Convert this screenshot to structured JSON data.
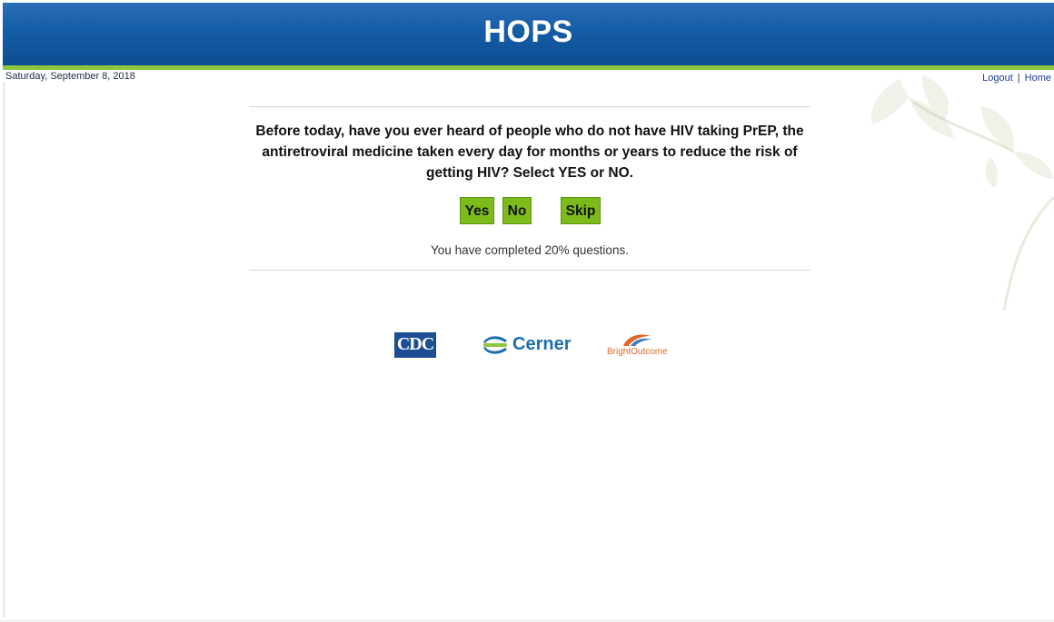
{
  "header": {
    "title": "HOPS"
  },
  "date": "Saturday, September 8, 2018",
  "nav": {
    "logout": "Logout",
    "separator": "|",
    "home": "Home"
  },
  "question": {
    "text": "Before today, have you ever heard of people who do not have HIV taking PrEP, the antiretroviral medicine taken every day for months or years to reduce the risk of getting HIV? Select YES or NO."
  },
  "buttons": {
    "yes": "Yes",
    "no": "No",
    "skip": "Skip"
  },
  "progress": {
    "text": "You have completed 20% questions.",
    "percent": 20
  },
  "logos": {
    "cdc": "CDC",
    "cerner": "Cerner",
    "bright": "BrightOutcome"
  },
  "colors": {
    "header_blue": "#155ca6",
    "accent_green": "#8cc63f",
    "button_green": "#7dbb1a",
    "link_blue": "#1a3a9b"
  }
}
